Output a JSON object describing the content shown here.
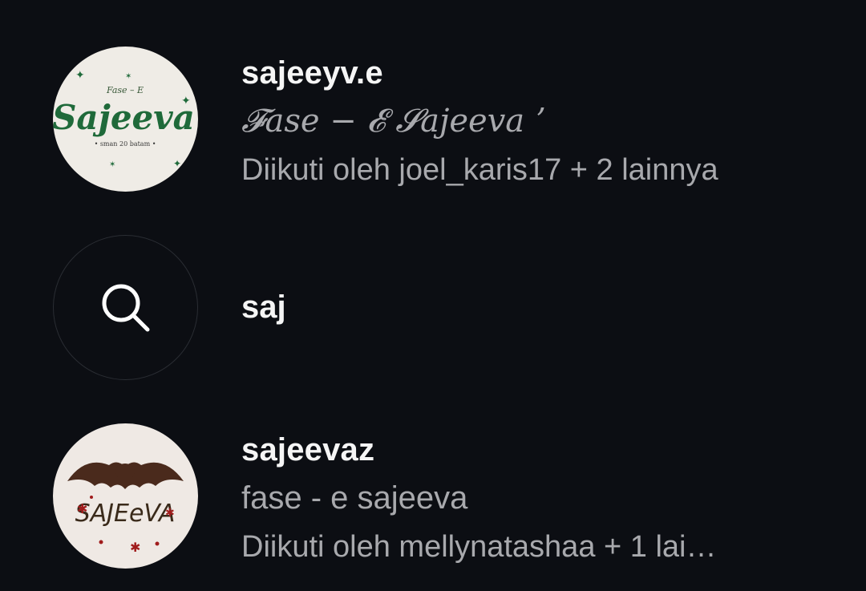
{
  "results": [
    {
      "username": "sajeeyv.e",
      "full_name": "𝓕ase − 𝓔 𝓢ajeeva ʼ",
      "followed_by": "Diikuti oleh joel_karis17 + 2 lainnya",
      "avatar_text": "Sajeeva",
      "avatar_subtext": "• sman 20 batam •"
    },
    {
      "query": "saj"
    },
    {
      "username": "sajeevaz",
      "full_name": "fase - e sajeeva",
      "followed_by": "Diikuti oleh mellynatashaa + 1 lai…",
      "avatar_text": "SAJEeVA"
    }
  ],
  "colors": {
    "background": "#0c0e13",
    "primary_text": "#f5f5f5",
    "secondary_text": "#a8a9ad",
    "avatar1_green": "#1f6a3a",
    "avatar2_bat": "#4a2a1c",
    "avatar2_red": "#a01c1c"
  },
  "icons": {
    "search_row": "search-icon"
  }
}
